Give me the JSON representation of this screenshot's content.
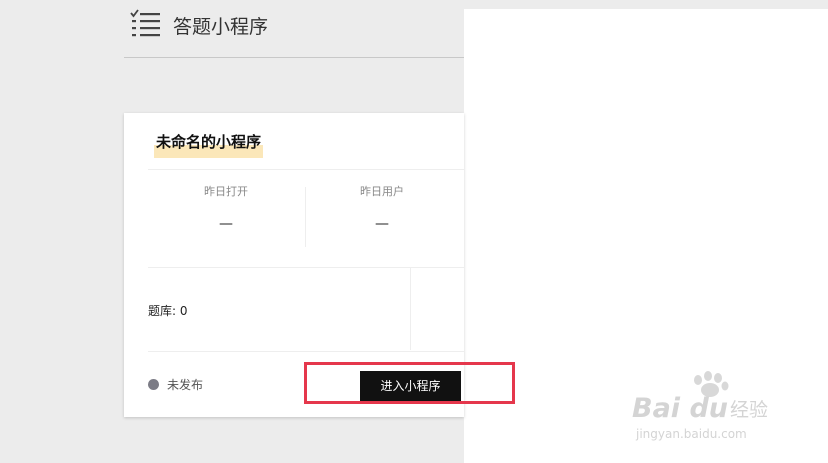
{
  "header": {
    "title": "答题小程序",
    "icon": "list-check-icon"
  },
  "card": {
    "title": "未命名的小程序",
    "stats": [
      {
        "label": "昨日打开",
        "value": "—"
      },
      {
        "label": "昨日用户",
        "value": "—"
      }
    ],
    "bank_label": "题库: 0",
    "status_label": "未发布",
    "status_color": "#7c7c86",
    "enter_button": "进入小程序"
  },
  "annotation": {
    "highlight_color": "#e5374c"
  },
  "watermark": {
    "brand": "Bai du",
    "brand_cn": "经验",
    "url": "jingyan.baidu.com"
  }
}
